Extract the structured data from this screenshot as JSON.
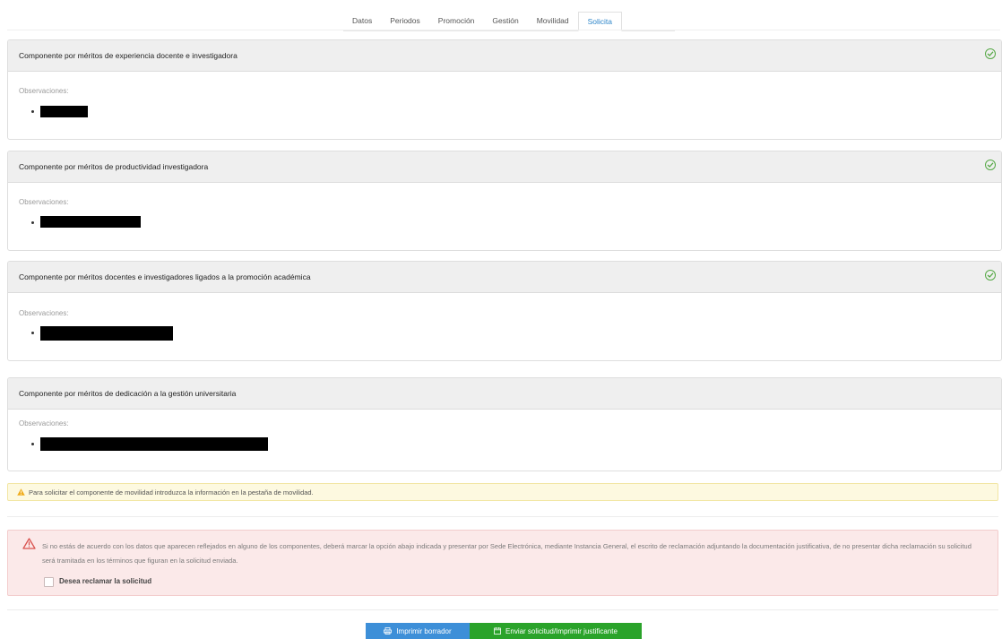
{
  "tabs": [
    "Datos",
    "Periodos",
    "Promoción",
    "Gestión",
    "Movilidad",
    "Solicita"
  ],
  "active_tab": "Solicita",
  "panels": [
    {
      "title": "Componente por méritos de experiencia docente e investigadora",
      "obs_label": "Observaciones:",
      "checked": true
    },
    {
      "title": "Componente por méritos de productividad investigadora",
      "obs_label": "Observaciones:",
      "checked": true
    },
    {
      "title": "Componente por méritos docentes e investigadores ligados a la promoción académica",
      "obs_label": "Observaciones:",
      "checked": true
    },
    {
      "title": "Componente por méritos de dedicación a la gestión universitaria",
      "obs_label": "Observaciones:",
      "checked": false
    }
  ],
  "warning": {
    "text": "Para solicitar el componente de movilidad introduzca la información en la pestaña de movilidad."
  },
  "alert": {
    "text": "Si no estás de acuerdo con los datos que aparecen reflejados en alguno de los componentes, deberá marcar la opción abajo indicada y presentar por Sede Electrónica, mediante Instancia General, el escrito de reclamación adjuntando la documentación justificativa, de no presentar dicha reclamación su solicitud será tramitada en los términos que figuran en la solicitud enviada.",
    "checkbox_label": "Desea reclamar la solicitud"
  },
  "buttons": {
    "print_draft": "Imprimir borrador",
    "send": "Enviar solicitud/Imprimir justificante"
  },
  "colors": {
    "accent": "#2e86c9",
    "check": "#55a845",
    "blue_button": "#3d8fd8",
    "green_button": "#2aa32a"
  }
}
